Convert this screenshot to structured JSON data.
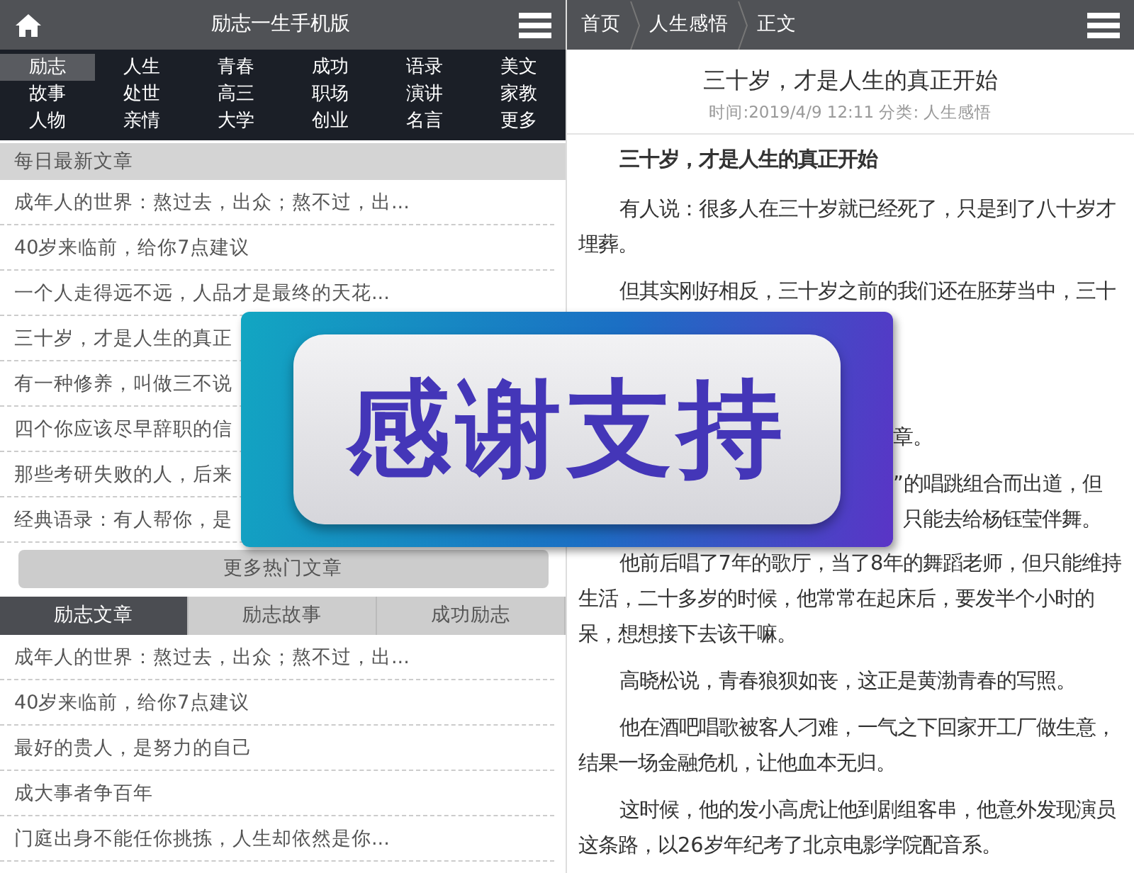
{
  "site_header": {
    "title": "励志一生手机版"
  },
  "categories": [
    {
      "label": "励志",
      "selected": true
    },
    {
      "label": "人生",
      "selected": false
    },
    {
      "label": "青春",
      "selected": false
    },
    {
      "label": "成功",
      "selected": false
    },
    {
      "label": "语录",
      "selected": false
    },
    {
      "label": "美文",
      "selected": false
    },
    {
      "label": "故事",
      "selected": false
    },
    {
      "label": "处世",
      "selected": false
    },
    {
      "label": "高三",
      "selected": false
    },
    {
      "label": "职场",
      "selected": false
    },
    {
      "label": "演讲",
      "selected": false
    },
    {
      "label": "家教",
      "selected": false
    },
    {
      "label": "人物",
      "selected": false
    },
    {
      "label": "亲情",
      "selected": false
    },
    {
      "label": "大学",
      "selected": false
    },
    {
      "label": "创业",
      "selected": false
    },
    {
      "label": "名言",
      "selected": false
    },
    {
      "label": "更多",
      "selected": false
    }
  ],
  "latest": {
    "heading": "每日最新文章",
    "items": [
      "成年人的世界：熬过去，出众；熬不过，出...",
      "40岁来临前，给你7点建议",
      "一个人走得远不远，人品才是最终的天花...",
      "三十岁，才是人生的真正",
      "有一种修养，叫做三不说",
      "四个你应该尽早辞职的信",
      "那些考研失败的人，后来",
      "经典语录：有人帮你，是"
    ],
    "more_button": "更多热门文章"
  },
  "tabs": [
    {
      "label": "励志文章",
      "selected": true
    },
    {
      "label": "励志故事",
      "selected": false
    },
    {
      "label": "成功励志",
      "selected": false
    }
  ],
  "tab_items": [
    "成年人的世界：熬过去，出众；熬不过，出...",
    "40岁来临前，给你7点建议",
    "最好的贵人，是努力的自己",
    "成大事者争百年",
    "门庭出身不能任你挑拣，人生却依然是你..."
  ],
  "breadcrumb": [
    "首页",
    "人生感悟",
    "正文"
  ],
  "article": {
    "title": "三十岁，才是人生的真正开始",
    "meta": "时间:2019/4/9 12:11 分类: 人生感悟",
    "paragraphs": [
      {
        "kind": "heading",
        "text": "三十岁，才是人生的真正开始"
      },
      {
        "kind": "text",
        "text": "有人说：很多人在三十岁就已经死了，只是到了八十岁才埋葬。"
      },
      {
        "kind": "text",
        "text": "但其实刚好相反，三十岁之前的我们还在胚芽当中，三十"
      },
      {
        "kind": "fragment",
        "lines": [
          "章。",
          "”的唱跳组合而出道，但",
          "只能去给杨钰莹伴舞。"
        ]
      },
      {
        "kind": "text",
        "text": "他前后唱了7年的歌厅，当了8年的舞蹈老师，但只能维持生活，二十多岁的时候，他常常在起床后，要发半个小时的呆，想想接下去该干嘛。"
      },
      {
        "kind": "text",
        "text": "高晓松说，青春狼狈如丧，这正是黄渤青春的写照。"
      },
      {
        "kind": "text",
        "text": "他在酒吧唱歌被客人刁难，一气之下回家开工厂做生意，结果一场金融危机，让他血本无归。"
      },
      {
        "kind": "text",
        "text": "这时候，他的发小高虎让他到剧组客串，他意外发现演员这条路，以26岁年纪考了北京电影学院配音系。"
      }
    ]
  },
  "overlay": {
    "text": "感谢支持"
  }
}
